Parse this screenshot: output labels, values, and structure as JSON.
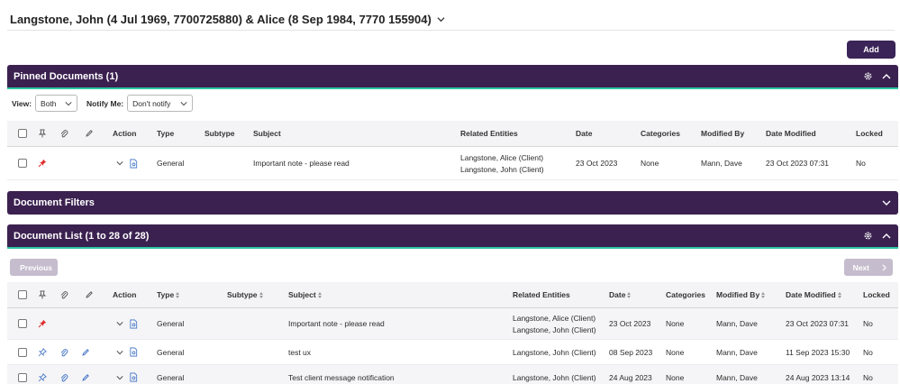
{
  "client": {
    "title": "Langstone, John (4 Jul 1969, 7700725880) & Alice (8 Sep 1984, 7770 155904)"
  },
  "toolbar": {
    "add_label": "Add"
  },
  "pinned": {
    "title": "Pinned Documents (1)",
    "view_label": "View:",
    "view_value": "Both",
    "notify_label": "Notify Me:",
    "notify_value": "Don't notify",
    "headers": {
      "action": "Action",
      "type": "Type",
      "subtype": "Subtype",
      "subject": "Subject",
      "related": "Related Entities",
      "date": "Date",
      "categories": "Categories",
      "modified_by": "Modified By",
      "date_modified": "Date Modified",
      "locked": "Locked"
    },
    "rows": [
      {
        "type": "General",
        "subtype": "",
        "subject": "Important note - please read",
        "related": [
          "Langstone, Alice (Client)",
          "Langstone, John (Client)"
        ],
        "date": "23 Oct 2023",
        "categories": "None",
        "modified_by": "Mann, Dave",
        "date_modified": "23 Oct 2023 07:31",
        "locked": "No",
        "pinned": true
      }
    ]
  },
  "filters": {
    "title": "Document Filters"
  },
  "list": {
    "title": "Document List (1 to 28 of 28)",
    "prev_label": "Previous",
    "next_label": "Next",
    "headers": {
      "action": "Action",
      "type": "Type",
      "subtype": "Subtype",
      "subject": "Subject",
      "related": "Related Entities",
      "date": "Date",
      "categories": "Categories",
      "modified_by": "Modified By",
      "date_modified": "Date Modified",
      "locked": "Locked"
    },
    "rows": [
      {
        "type": "General",
        "subject": "Important note - please read",
        "related": [
          "Langstone, Alice (Client)",
          "Langstone, John (Client)"
        ],
        "date": "23 Oct 2023",
        "categories": "None",
        "modified_by": "Mann, Dave",
        "date_modified": "23 Oct 2023 07:31",
        "locked": "No",
        "pinned": true
      },
      {
        "type": "General",
        "subject": "test ux",
        "related": [
          "Langstone, John (Client)"
        ],
        "date": "08 Sep 2023",
        "categories": "None",
        "modified_by": "Mann, Dave",
        "date_modified": "11 Sep 2023 15:30",
        "locked": "No",
        "pinned": false
      },
      {
        "type": "General",
        "subject": "Test client message notification",
        "related": [
          "Langstone, John (Client)"
        ],
        "date": "24 Aug 2023",
        "categories": "None",
        "modified_by": "Mann, Dave",
        "date_modified": "24 Aug 2023 13:14",
        "locked": "No",
        "pinned": false
      }
    ]
  },
  "colors": {
    "header_bg": "#3b2150",
    "accent_line": "#2bc6a3",
    "pin_red": "#e02d2d",
    "icon_blue": "#3b6fc4"
  }
}
